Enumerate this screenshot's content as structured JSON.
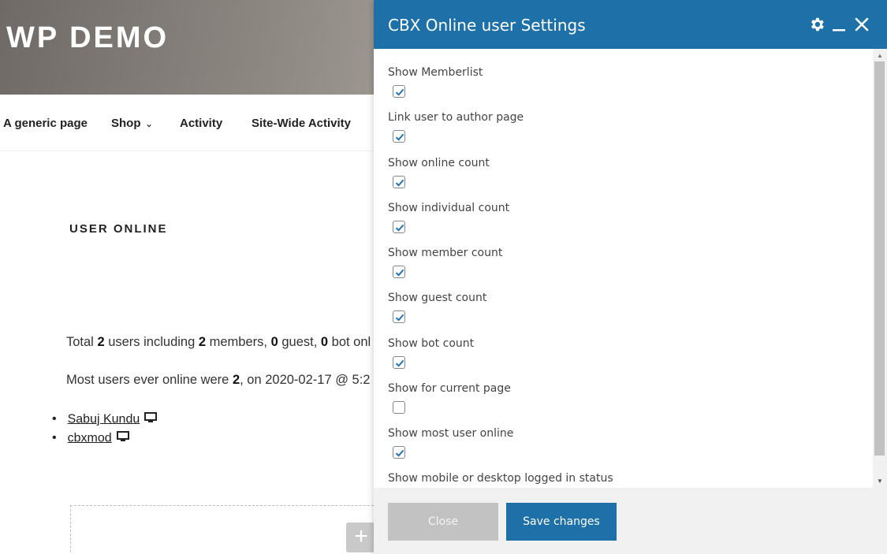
{
  "site": {
    "title": "WP DEMO",
    "nav": [
      {
        "label": "A generic page"
      },
      {
        "label": "Shop"
      },
      {
        "label": "Activity"
      },
      {
        "label": "Site-Wide Activity"
      }
    ],
    "widget_title": "USER ONLINE",
    "total_line": {
      "p1": "Total ",
      "total": "2",
      "p2": " users including ",
      "members": "2",
      "p3": " members, ",
      "guests": "0",
      "p4": " guest, ",
      "bots": "0",
      "p5": " bot onl"
    },
    "most_line": {
      "p1": "Most users ever online were ",
      "count": "2",
      "p2": ", on 2020-02-17 @ 5:2"
    },
    "users": [
      "Sabuj Kundu",
      "cbxmod"
    ]
  },
  "modal": {
    "title": "CBX Online user Settings",
    "icons": {
      "settings": "gear-icon",
      "minimize": "minimize-icon",
      "close": "close-icon"
    },
    "settings": [
      {
        "label": "Show Memberlist",
        "checked": true
      },
      {
        "label": "Link user to author page",
        "checked": true
      },
      {
        "label": "Show online count",
        "checked": true
      },
      {
        "label": "Show individual count",
        "checked": true
      },
      {
        "label": "Show member count",
        "checked": true
      },
      {
        "label": "Show guest count",
        "checked": true
      },
      {
        "label": "Show bot count",
        "checked": true
      },
      {
        "label": "Show for current page",
        "checked": false
      },
      {
        "label": "Show most user online",
        "checked": true
      },
      {
        "label": "Show mobile or desktop logged in status",
        "checked": null
      }
    ],
    "footer": {
      "close_label": "Close",
      "save_label": "Save changes"
    }
  },
  "colors": {
    "accent": "#1d70a8",
    "close_button": "#c2c2c2",
    "checkmark": "#2271b1"
  }
}
